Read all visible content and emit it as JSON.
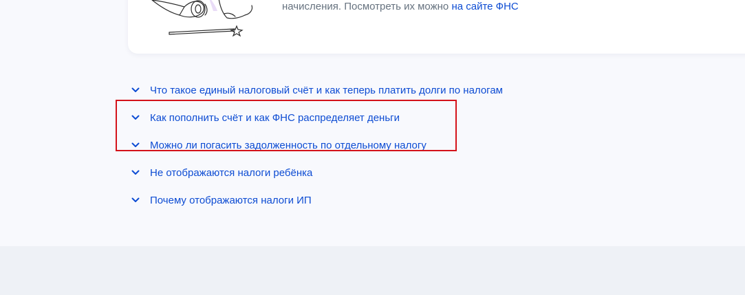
{
  "card": {
    "text_before": "начисления. Посмотреть их можно ",
    "link": "на сайте ФНС"
  },
  "faq": {
    "items": [
      {
        "label": "Что такое единый налоговый счёт и как теперь платить долги по налогам"
      },
      {
        "label": "Как пополнить счёт и как ФНС распределяет деньги"
      },
      {
        "label": "Можно ли погасить задолженность по отдельному налогу"
      },
      {
        "label": "Не отображаются налоги ребёнка"
      },
      {
        "label": "Почему отображаются налоги ИП"
      }
    ]
  },
  "colors": {
    "link": "#0d4cd3",
    "highlight": "#d4121a",
    "background": "#f8f9fd",
    "footer": "#eef1f6"
  },
  "icons": {
    "faq_toggle": "chevron-down-icon",
    "illustration": "magic-wand-illustration"
  }
}
